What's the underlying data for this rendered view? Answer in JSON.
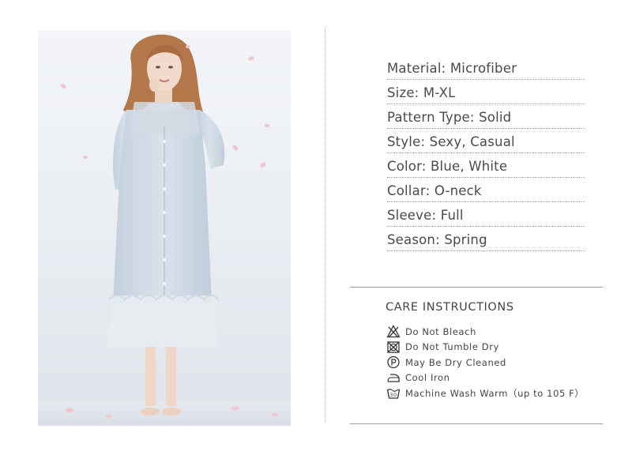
{
  "specs": [
    {
      "label": "Material:",
      "value": "Microfiber"
    },
    {
      "label": "Size:",
      "value": "M-XL"
    },
    {
      "label": "Pattern Type:",
      "value": "Solid"
    },
    {
      "label": "Style:",
      "value": "Sexy, Casual"
    },
    {
      "label": "Color:",
      "value": "Blue, White"
    },
    {
      "label": "Collar:",
      "value": "O-neck"
    },
    {
      "label": "Sleeve:",
      "value": "Full"
    },
    {
      "label": "Season:",
      "value": "Spring"
    }
  ],
  "care": {
    "title": "CARE  INSTRUCTIONS",
    "items": [
      {
        "icon": "no-bleach-icon",
        "label": "Do  Not  Bleach"
      },
      {
        "icon": "no-tumble-dry-icon",
        "label": "Do  Not  Tumble  Dry"
      },
      {
        "icon": "dry-clean-icon",
        "label": "May  Be  Dry  Cleaned"
      },
      {
        "icon": "cool-iron-icon",
        "label": "Cool  Iron"
      },
      {
        "icon": "machine-wash-icon",
        "label": "Machine  Wash  Warm（up  to  105  F）"
      }
    ]
  },
  "colors": {
    "dress": "#cfdbe6",
    "petals": "#f1c6cf",
    "backdrop": "#eef1f5",
    "hair": "#b4774a"
  }
}
